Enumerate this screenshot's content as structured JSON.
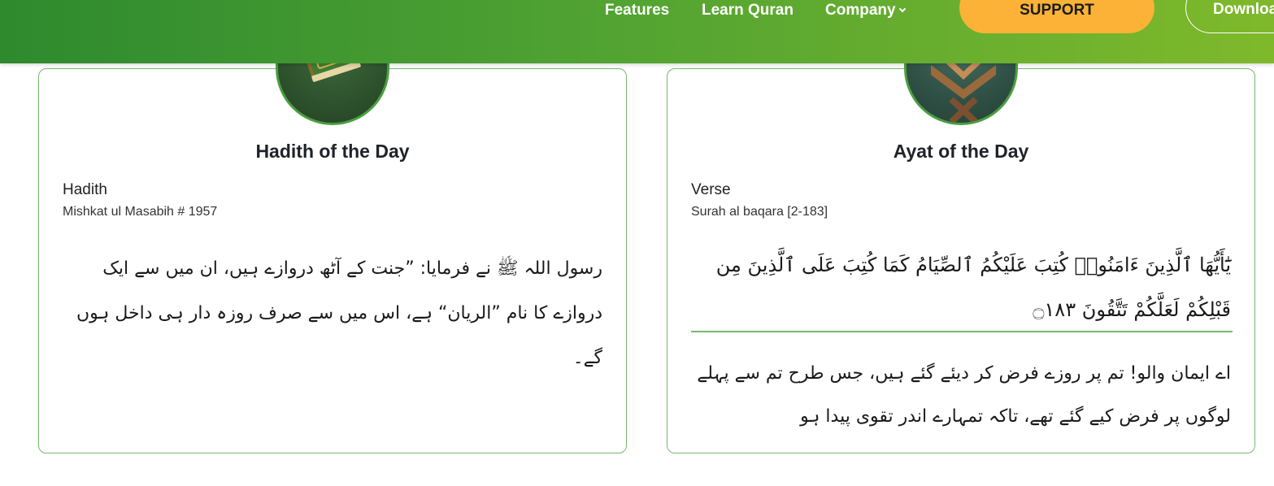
{
  "nav": {
    "links": [
      "Features",
      "Learn Quran",
      "Company"
    ],
    "support_label": "SUPPORT",
    "download_label": "Download"
  },
  "colors": {
    "nav_gradient_start": "#2e8a2e",
    "nav_gradient_end": "#7fb92b",
    "support_button": "#fbb236",
    "card_border": "#78b76e"
  },
  "hadith_card": {
    "icon": "book-icon",
    "title": "Hadith of the Day",
    "label": "Hadith",
    "reference": "Mishkat ul Masabih # 1957",
    "text": "رسول اللہ ﷺ نے فرمایا: ”جنت کے آٹھ دروازے ہیں، ان میں سے ایک دروازے کا نام ”الریان“ ہے، اس میں سے صرف روزہ دار ہی داخل ہوں گے۔"
  },
  "ayat_card": {
    "icon": "quran-stand-icon",
    "title": "Ayat of the Day",
    "label": "Verse",
    "reference": "Surah al baqara [2-183]",
    "arabic": "يَٰٓأَيُّهَا ٱلَّذِينَ ءَامَنُوا۟ كُتِبَ عَلَيْكُمُ ٱلصِّيَامُ كَمَا كُتِبَ عَلَى ٱلَّذِينَ مِن قَبْلِكُمْ لَعَلَّكُمْ تَتَّقُونَ ۝١٨٣",
    "translation": "اے ایمان والو! تم پر روزے فرض کر دیئے گئے ہیں، جس طرح تم سے پہلے لوگوں پر فرض کیے گئے تھے، تاکہ تمہارے اندر تقوی پیدا ہو"
  }
}
